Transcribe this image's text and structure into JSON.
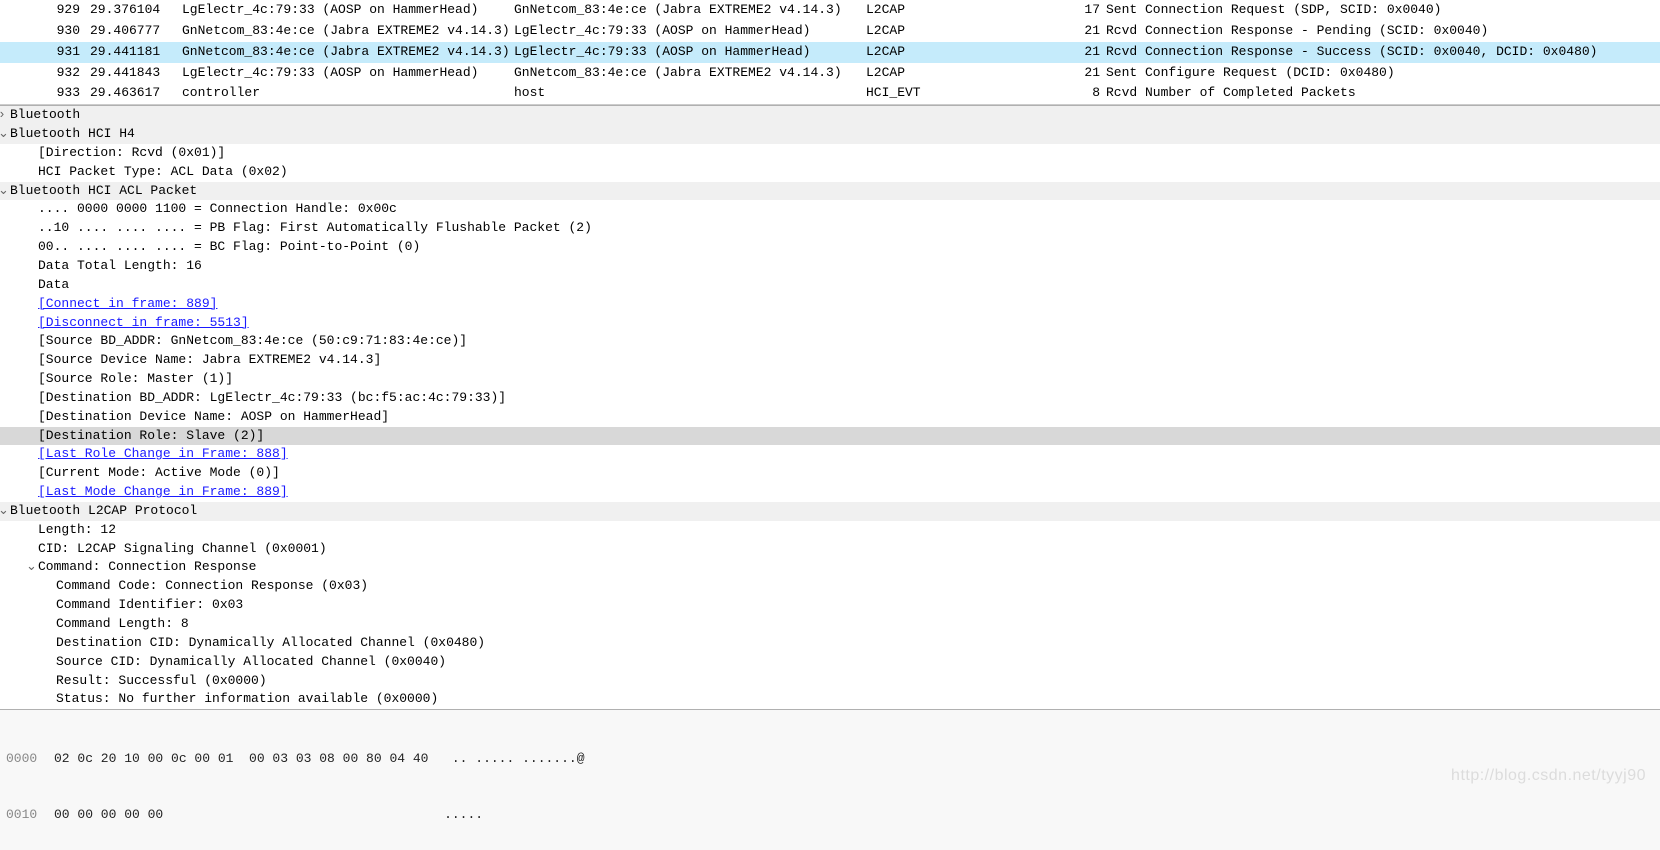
{
  "packets": [
    {
      "no": "929",
      "time": "29.376104",
      "src": "LgElectr_4c:79:33 (AOSP on HammerHead)",
      "dst": "GnNetcom_83:4e:ce (Jabra EXTREME2 v4.14.3)",
      "proto": "L2CAP",
      "len": "17",
      "info": "Sent Connection Request (SDP, SCID: 0x0040)",
      "sel": false
    },
    {
      "no": "930",
      "time": "29.406777",
      "src": "GnNetcom_83:4e:ce (Jabra EXTREME2 v4.14.3)",
      "dst": "LgElectr_4c:79:33 (AOSP on HammerHead)",
      "proto": "L2CAP",
      "len": "21",
      "info": "Rcvd Connection Response - Pending (SCID: 0x0040)",
      "sel": false
    },
    {
      "no": "931",
      "time": "29.441181",
      "src": "GnNetcom_83:4e:ce (Jabra EXTREME2 v4.14.3)",
      "dst": "LgElectr_4c:79:33 (AOSP on HammerHead)",
      "proto": "L2CAP",
      "len": "21",
      "info": "Rcvd Connection Response - Success (SCID: 0x0040, DCID: 0x0480)",
      "sel": true
    },
    {
      "no": "932",
      "time": "29.441843",
      "src": "LgElectr_4c:79:33 (AOSP on HammerHead)",
      "dst": "GnNetcom_83:4e:ce (Jabra EXTREME2 v4.14.3)",
      "proto": "L2CAP",
      "len": "21",
      "info": "Sent Configure Request (DCID: 0x0480)",
      "sel": false
    },
    {
      "no": "933",
      "time": "29.463617",
      "src": "controller",
      "dst": "host",
      "proto": "HCI_EVT",
      "len": "8",
      "info": "Rcvd Number of Completed Packets",
      "sel": false
    }
  ],
  "tree": {
    "bt": "Bluetooth",
    "h4": "Bluetooth HCI H4",
    "h4_dir": "[Direction: Rcvd (0x01)]",
    "h4_type": "HCI Packet Type: ACL Data (0x02)",
    "acl": "Bluetooth HCI ACL Packet",
    "acl_handle": ".... 0000 0000 1100 = Connection Handle: 0x00c",
    "acl_pb": "..10 .... .... .... = PB Flag: First Automatically Flushable Packet (2)",
    "acl_bc": "00.. .... .... .... = BC Flag: Point-to-Point (0)",
    "acl_len": "Data Total Length: 16",
    "acl_data": "Data",
    "acl_conn": "[Connect in frame: 889]",
    "acl_disc": "[Disconnect in frame: 5513]",
    "acl_srcbd": "[Source BD_ADDR: GnNetcom_83:4e:ce (50:c9:71:83:4e:ce)]",
    "acl_srcnm": "[Source Device Name: Jabra EXTREME2 v4.14.3]",
    "acl_srcrole": "[Source Role: Master (1)]",
    "acl_dstbd": "[Destination BD_ADDR: LgElectr_4c:79:33 (bc:f5:ac:4c:79:33)]",
    "acl_dstnm": "[Destination Device Name: AOSP on HammerHead]",
    "acl_dstrole": "[Destination Role: Slave (2)]",
    "acl_lastrole": "[Last Role Change in Frame: 888]",
    "acl_curmode": "[Current Mode: Active Mode (0)]",
    "acl_lastmode": "[Last Mode Change in Frame: 889]",
    "l2cap": "Bluetooth L2CAP Protocol",
    "l2_len": "Length: 12",
    "l2_cid": "CID: L2CAP Signaling Channel (0x0001)",
    "l2_cmd": "Command: Connection Response",
    "l2_code": "Command Code: Connection Response (0x03)",
    "l2_id": "Command Identifier: 0x03",
    "l2_clen": "Command Length: 8",
    "l2_dcid": "Destination CID: Dynamically Allocated Channel (0x0480)",
    "l2_scid": "Source CID: Dynamically Allocated Channel (0x0040)",
    "l2_res": "Result: Successful (0x0000)",
    "l2_stat": "Status: No further information available (0x0000)"
  },
  "hex": {
    "r0_off": "0000",
    "r0_b": "02 0c 20 10 00 0c 00 01  00 03 03 08 00 80 04 40",
    "r0_a": ".. ..... .......@",
    "r1_off": "0010",
    "r1_b": "00 00 00 00 00",
    "r1_a": "....."
  },
  "watermark": "http://blog.csdn.net/tyyj90"
}
